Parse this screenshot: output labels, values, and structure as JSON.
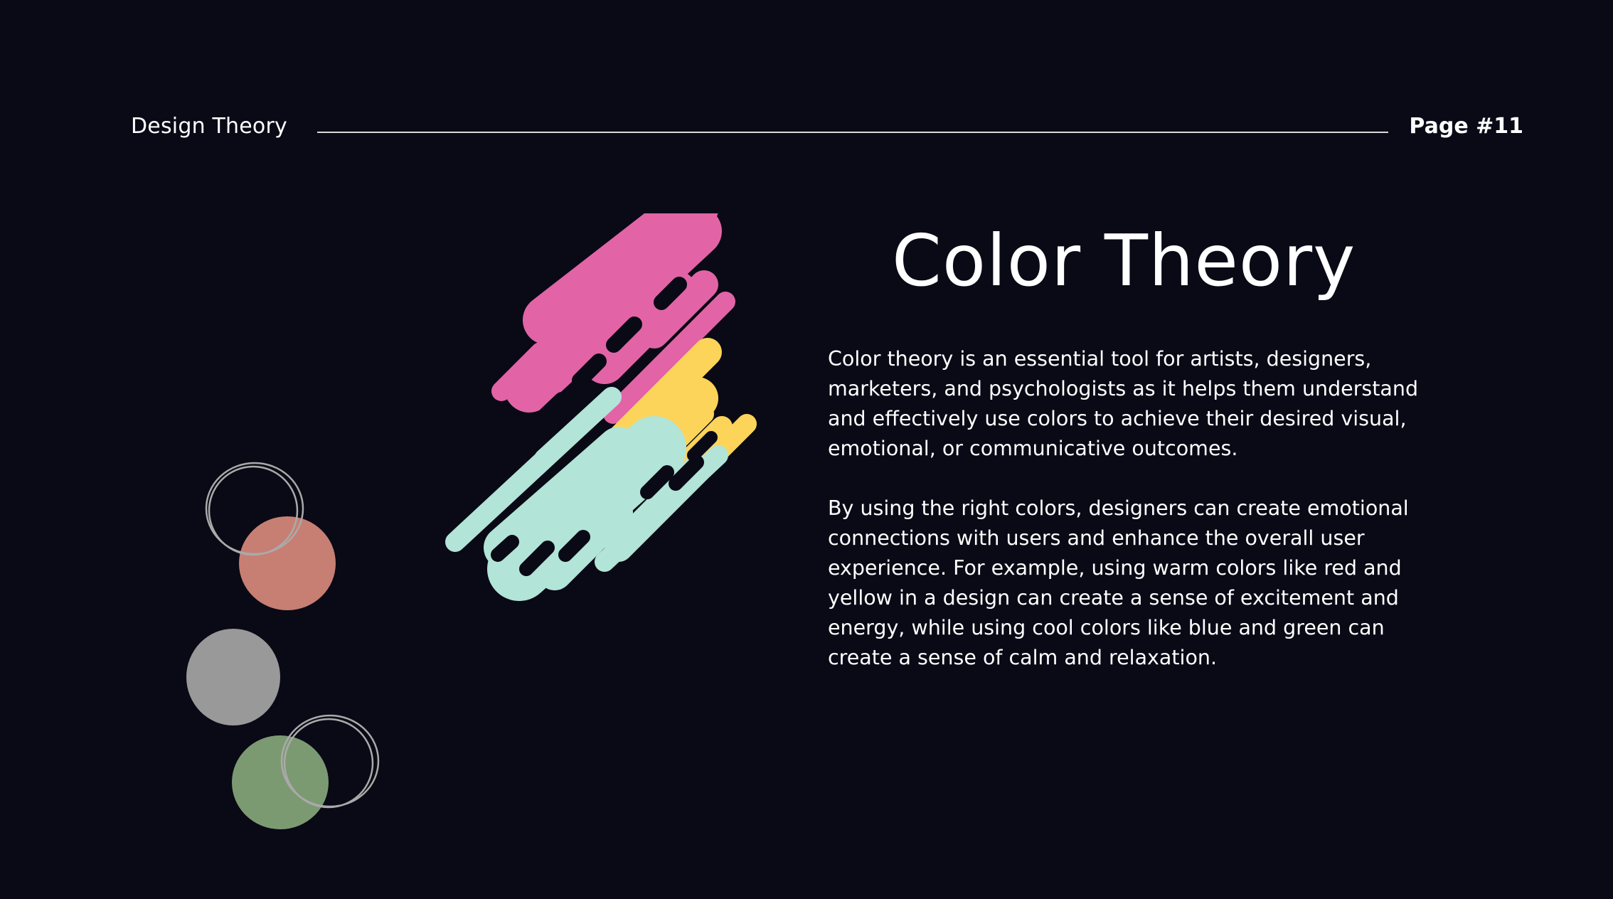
{
  "header": {
    "section_label": "Design Theory",
    "page_label": "Page #11"
  },
  "main": {
    "title": "Color Theory",
    "paragraphs": [
      "Color theory is an essential tool for artists, designers, marketers, and psychologists as it helps them understand and effectively use colors to achieve their desired visual, emotional, or communicative outcomes.",
      "By using the right colors, designers can create emotional connections with users and enhance the overall user experience. For example, using warm colors like red and yellow in a design can create a sense of excitement and energy, while using cool colors like blue and green can create a sense of calm and relaxation."
    ]
  },
  "colors": {
    "background": "#0a0916",
    "pink": "#e264a6",
    "yellow": "#fdd45a",
    "mint": "#b2e4d7",
    "salmon": "#c77f73",
    "gray": "#999999",
    "green": "#7c9a72",
    "outline": "#aaaaaa"
  },
  "icons": {
    "paint_drip": "paint-drip-illustration",
    "color_dots": "color-swatch-dots"
  }
}
